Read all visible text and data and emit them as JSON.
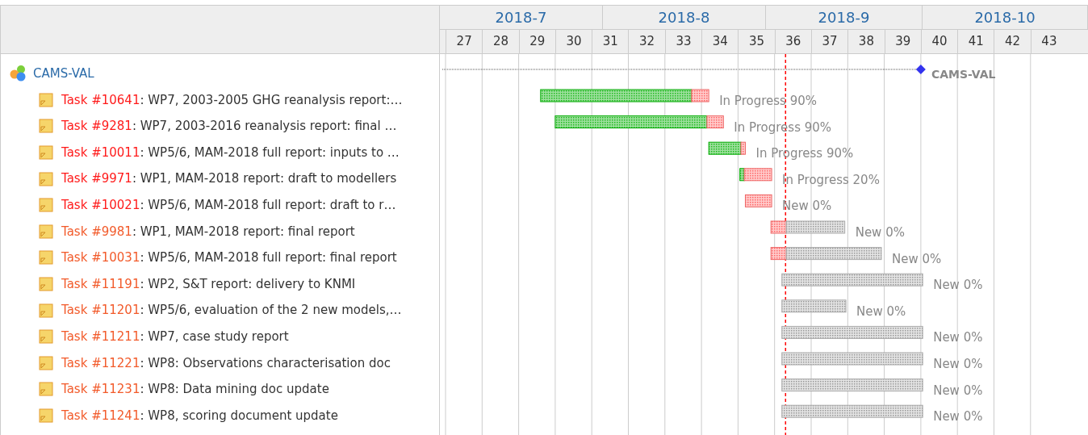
{
  "project": {
    "name": "CAMS-VAL",
    "milestone_label": "CAMS-VAL"
  },
  "months": [
    "2018-7",
    "2018-8",
    "2018-9",
    "2018-10"
  ],
  "weeks": [
    "27",
    "28",
    "29",
    "30",
    "31",
    "32",
    "33",
    "34",
    "35",
    "36",
    "37",
    "38",
    "39",
    "40",
    "41",
    "42",
    "43"
  ],
  "tasks": [
    {
      "id": "Task #10641",
      "title": ": WP7, 2003-2005 GHG reanalysis report:…",
      "color": "#ff1a1a",
      "status": "In Progress 90%"
    },
    {
      "id": "Task #9281",
      "title": ": WP7, 2003-2016 reanalysis report: final …",
      "color": "#ff1a1a",
      "status": "In Progress 90%"
    },
    {
      "id": "Task #10011",
      "title": ": WP5/6, MAM-2018 full report: inputs to …",
      "color": "#ff1a1a",
      "status": "In Progress 90%"
    },
    {
      "id": "Task #9971",
      "title": ": WP1, MAM-2018 report: draft to modellers",
      "color": "#ff1a1a",
      "status": "In Progress 20%"
    },
    {
      "id": "Task #10021",
      "title": ": WP5/6, MAM-2018 full report: draft to r…",
      "color": "#ff1a1a",
      "status": "New 0%"
    },
    {
      "id": "Task #9981",
      "title": ": WP1, MAM-2018 report: final report",
      "color": "#f25a2a",
      "status": "New 0%"
    },
    {
      "id": "Task #10031",
      "title": ": WP5/6, MAM-2018 full report: final report",
      "color": "#f25a2a",
      "status": "New 0%"
    },
    {
      "id": "Task #11191",
      "title": ": WP2, S&T report: delivery to KNMI",
      "color": "#f25a2a",
      "status": "New 0%"
    },
    {
      "id": "Task #11201",
      "title": ": WP5/6, evaluation of the 2 new models,…",
      "color": "#f25a2a",
      "status": "New 0%"
    },
    {
      "id": "Task #11211",
      "title": ": WP7, case study report",
      "color": "#f25a2a",
      "status": "New 0%"
    },
    {
      "id": "Task #11221",
      "title": ": WP8: Observations characterisation doc",
      "color": "#f25a2a",
      "status": "New 0%"
    },
    {
      "id": "Task #11231",
      "title": ": WP8: Data mining doc update",
      "color": "#f25a2a",
      "status": "New 0%"
    },
    {
      "id": "Task #11241",
      "title": ": WP8, scoring document update",
      "color": "#f25a2a",
      "status": "New 0%"
    }
  ]
}
